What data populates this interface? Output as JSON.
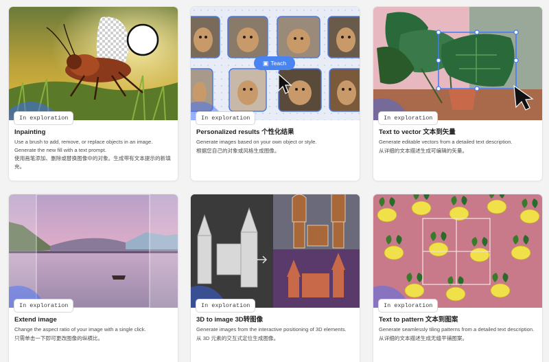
{
  "cards": [
    {
      "badge": "In exploration",
      "title": "Inpainting",
      "description": "Use a brush to add, remove, or replace objects in an image. Generate the new fill with a text prompt.",
      "description_cn": "使用画笔添加、删除或替换图像中的对象。生成带有文本提示的新填充。",
      "thumb_icon": "cricket-inpainting-image"
    },
    {
      "badge": "In exploration",
      "title": "Personalized results 个性化结果",
      "description": "Generate images based on your own object or style.",
      "description_cn": "根据您自己的对象或风格生成图像。",
      "thumb_icon": "dog-portraits-grid-image",
      "teach_label": "Teach"
    },
    {
      "badge": "In exploration",
      "title": "Text to vector 文本到矢量",
      "description": "Generate editable vectors from a detailed text description.",
      "description_cn": "从详细的文本描述生成可编辑的矢量。",
      "thumb_icon": "monstera-vector-image"
    },
    {
      "badge": "In exploration",
      "title": "Extend image",
      "description": "Change the aspect ratio of your image with a single click.",
      "description_cn": "只需单击一下即可更改图像的纵横比。",
      "thumb_icon": "lake-landscape-image"
    },
    {
      "badge": "In exploration",
      "title": "3D to image 3D转图像",
      "description": "Generate images from the interactive positioning of 3D elements.",
      "description_cn": "从 3D 元素的交互式定位生成图像。",
      "thumb_icon": "castle-3d-image"
    },
    {
      "badge": "In exploration",
      "title": "Text to pattern 文本到图案",
      "description": "Generate seamlessly tiling patterns from a detailed text description.",
      "description_cn": "从详细的文本描述生成无缝平铺图案。",
      "thumb_icon": "lemon-pattern-image"
    }
  ],
  "colors": {
    "page_background": "#f3f3f3",
    "card_background": "#ffffff",
    "teach_button": "#4a84f0"
  }
}
